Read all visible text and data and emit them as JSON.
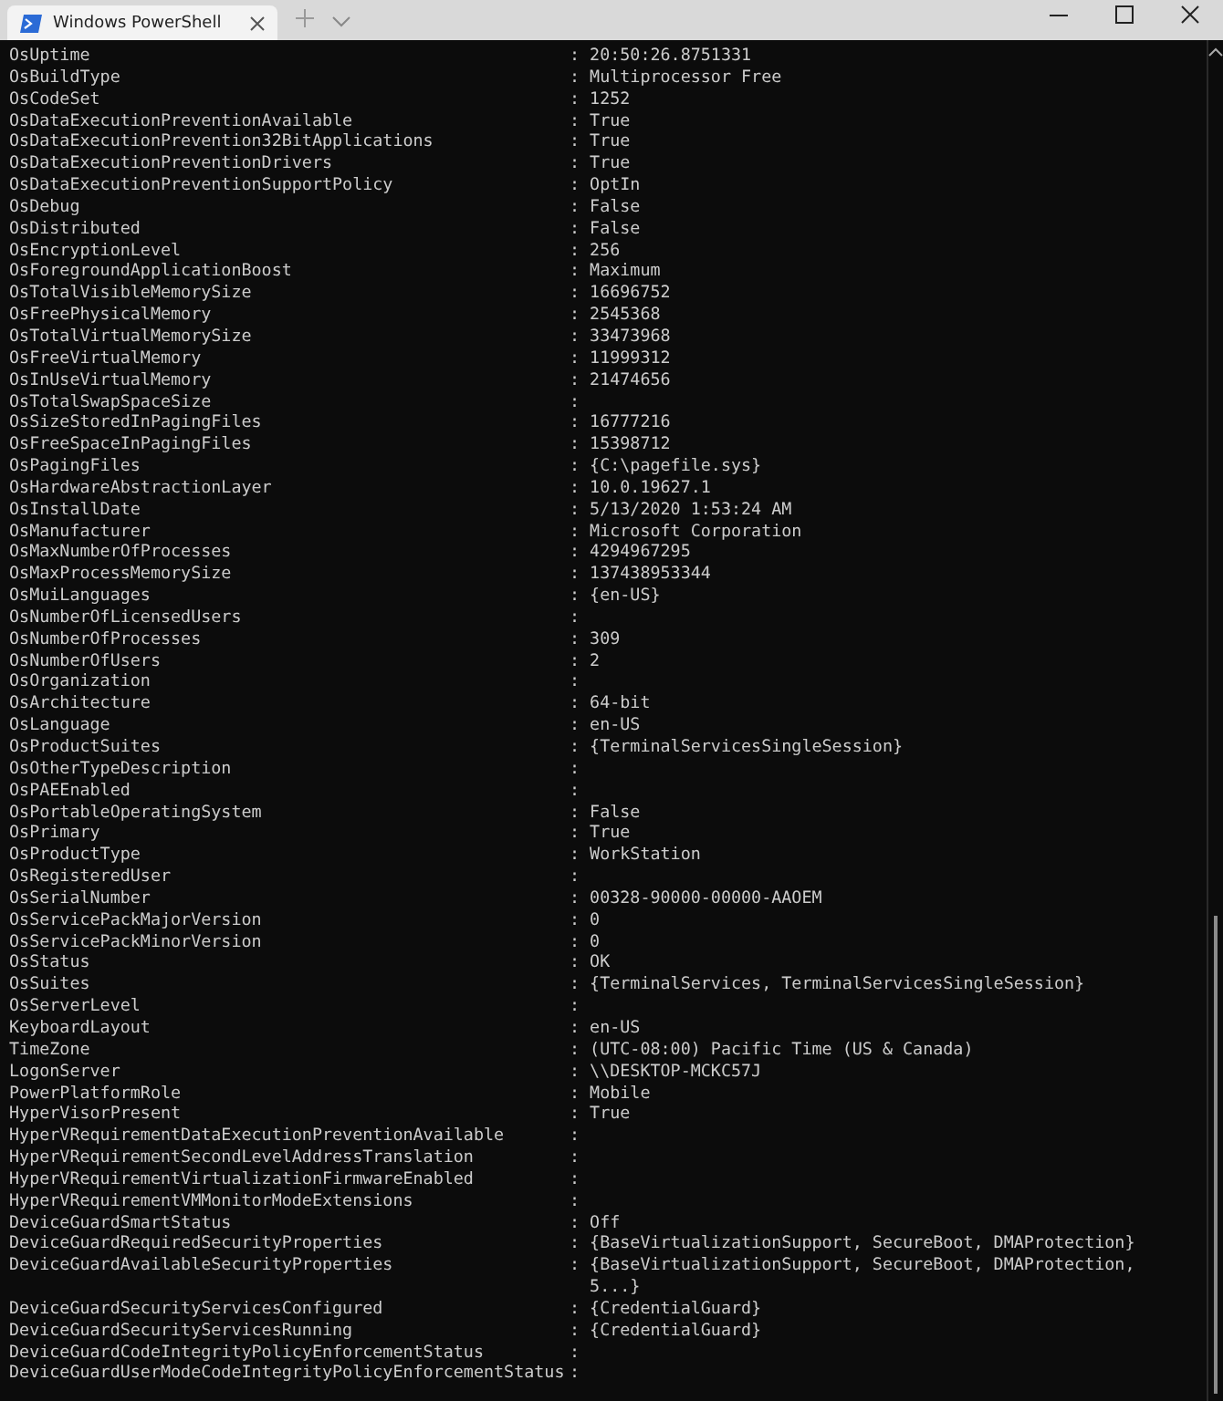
{
  "tab": {
    "title": "Windows PowerShell",
    "selected": true
  },
  "rows": [
    {
      "kind": "property",
      "name": "OsUptime",
      "value": ": 20:50:26.8751331"
    },
    {
      "kind": "property",
      "name": "OsBuildType",
      "value": ": Multiprocessor Free"
    },
    {
      "kind": "property",
      "name": "OsCodeSet",
      "value": ": 1252"
    },
    {
      "kind": "property",
      "name": "OsDataExecutionPreventionAvailable",
      "value": ": True"
    },
    {
      "kind": "property",
      "name": "OsDataExecutionPrevention32BitApplications",
      "value": ": True"
    },
    {
      "kind": "property",
      "name": "OsDataExecutionPreventionDrivers",
      "value": ": True"
    },
    {
      "kind": "property",
      "name": "OsDataExecutionPreventionSupportPolicy",
      "value": ": OptIn"
    },
    {
      "kind": "property",
      "name": "OsDebug",
      "value": ": False"
    },
    {
      "kind": "property",
      "name": "OsDistributed",
      "value": ": False"
    },
    {
      "kind": "property",
      "name": "OsEncryptionLevel",
      "value": ": 256"
    },
    {
      "kind": "property",
      "name": "OsForegroundApplicationBoost",
      "value": ": Maximum"
    },
    {
      "kind": "property",
      "name": "OsTotalVisibleMemorySize",
      "value": ": 16696752"
    },
    {
      "kind": "property",
      "name": "OsFreePhysicalMemory",
      "value": ": 2545368"
    },
    {
      "kind": "property",
      "name": "OsTotalVirtualMemorySize",
      "value": ": 33473968"
    },
    {
      "kind": "property",
      "name": "OsFreeVirtualMemory",
      "value": ": 11999312"
    },
    {
      "kind": "property",
      "name": "OsInUseVirtualMemory",
      "value": ": 21474656"
    },
    {
      "kind": "property",
      "name": "OsTotalSwapSpaceSize",
      "value": ":"
    },
    {
      "kind": "property",
      "name": "OsSizeStoredInPagingFiles",
      "value": ": 16777216"
    },
    {
      "kind": "property",
      "name": "OsFreeSpaceInPagingFiles",
      "value": ": 15398712"
    },
    {
      "kind": "property",
      "name": "OsPagingFiles",
      "value": ": {C:\\pagefile.sys}"
    },
    {
      "kind": "property",
      "name": "OsHardwareAbstractionLayer",
      "value": ": 10.0.19627.1"
    },
    {
      "kind": "property",
      "name": "OsInstallDate",
      "value": ": 5/13/2020 1:53:24 AM"
    },
    {
      "kind": "property",
      "name": "OsManufacturer",
      "value": ": Microsoft Corporation"
    },
    {
      "kind": "property",
      "name": "OsMaxNumberOfProcesses",
      "value": ": 4294967295"
    },
    {
      "kind": "property",
      "name": "OsMaxProcessMemorySize",
      "value": ": 137438953344"
    },
    {
      "kind": "property",
      "name": "OsMuiLanguages",
      "value": ": {en-US}"
    },
    {
      "kind": "property",
      "name": "OsNumberOfLicensedUsers",
      "value": ":"
    },
    {
      "kind": "property",
      "name": "OsNumberOfProcesses",
      "value": ": 309"
    },
    {
      "kind": "property",
      "name": "OsNumberOfUsers",
      "value": ": 2"
    },
    {
      "kind": "property",
      "name": "OsOrganization",
      "value": ":"
    },
    {
      "kind": "property",
      "name": "OsArchitecture",
      "value": ": 64-bit"
    },
    {
      "kind": "property",
      "name": "OsLanguage",
      "value": ": en-US"
    },
    {
      "kind": "property",
      "name": "OsProductSuites",
      "value": ": {TerminalServicesSingleSession}"
    },
    {
      "kind": "property",
      "name": "OsOtherTypeDescription",
      "value": ":"
    },
    {
      "kind": "property",
      "name": "OsPAEEnabled",
      "value": ":"
    },
    {
      "kind": "property",
      "name": "OsPortableOperatingSystem",
      "value": ": False"
    },
    {
      "kind": "property",
      "name": "OsPrimary",
      "value": ": True"
    },
    {
      "kind": "property",
      "name": "OsProductType",
      "value": ": WorkStation"
    },
    {
      "kind": "property",
      "name": "OsRegisteredUser",
      "value": ":"
    },
    {
      "kind": "property",
      "name": "OsSerialNumber",
      "value": ": 00328-90000-00000-AAOEM"
    },
    {
      "kind": "property",
      "name": "OsServicePackMajorVersion",
      "value": ": 0"
    },
    {
      "kind": "property",
      "name": "OsServicePackMinorVersion",
      "value": ": 0"
    },
    {
      "kind": "property",
      "name": "OsStatus",
      "value": ": OK"
    },
    {
      "kind": "property",
      "name": "OsSuites",
      "value": ": {TerminalServices, TerminalServicesSingleSession}"
    },
    {
      "kind": "property",
      "name": "OsServerLevel",
      "value": ":"
    },
    {
      "kind": "property",
      "name": "KeyboardLayout",
      "value": ": en-US"
    },
    {
      "kind": "property",
      "name": "TimeZone",
      "value": ": (UTC-08:00) Pacific Time (US & Canada)"
    },
    {
      "kind": "property",
      "name": "LogonServer",
      "value": ": \\\\DESKTOP-MCKC57J"
    },
    {
      "kind": "property",
      "name": "PowerPlatformRole",
      "value": ": Mobile"
    },
    {
      "kind": "property",
      "name": "HyperVisorPresent",
      "value": ": True"
    },
    {
      "kind": "property",
      "name": "HyperVRequirementDataExecutionPreventionAvailable",
      "value": ":"
    },
    {
      "kind": "property",
      "name": "HyperVRequirementSecondLevelAddressTranslation",
      "value": ":"
    },
    {
      "kind": "property",
      "name": "HyperVRequirementVirtualizationFirmwareEnabled",
      "value": ":"
    },
    {
      "kind": "property",
      "name": "HyperVRequirementVMMonitorModeExtensions",
      "value": ":"
    },
    {
      "kind": "property",
      "name": "DeviceGuardSmartStatus",
      "value": ": Off"
    },
    {
      "kind": "property",
      "name": "DeviceGuardRequiredSecurityProperties",
      "value": ": {BaseVirtualizationSupport, SecureBoot, DMAProtection}"
    },
    {
      "kind": "property",
      "name": "DeviceGuardAvailableSecurityProperties",
      "value": ": {BaseVirtualizationSupport, SecureBoot, DMAProtection,"
    },
    {
      "kind": "continuation",
      "value": "5...}"
    },
    {
      "kind": "property",
      "name": "DeviceGuardSecurityServicesConfigured",
      "value": ": {CredentialGuard}"
    },
    {
      "kind": "property",
      "name": "DeviceGuardSecurityServicesRunning",
      "value": ": {CredentialGuard}"
    },
    {
      "kind": "property",
      "name": "DeviceGuardCodeIntegrityPolicyEnforcementStatus",
      "value": ":"
    },
    {
      "kind": "property",
      "name": "DeviceGuardUserModeCodeIntegrityPolicyEnforcementStatus",
      "value": ":"
    }
  ]
}
